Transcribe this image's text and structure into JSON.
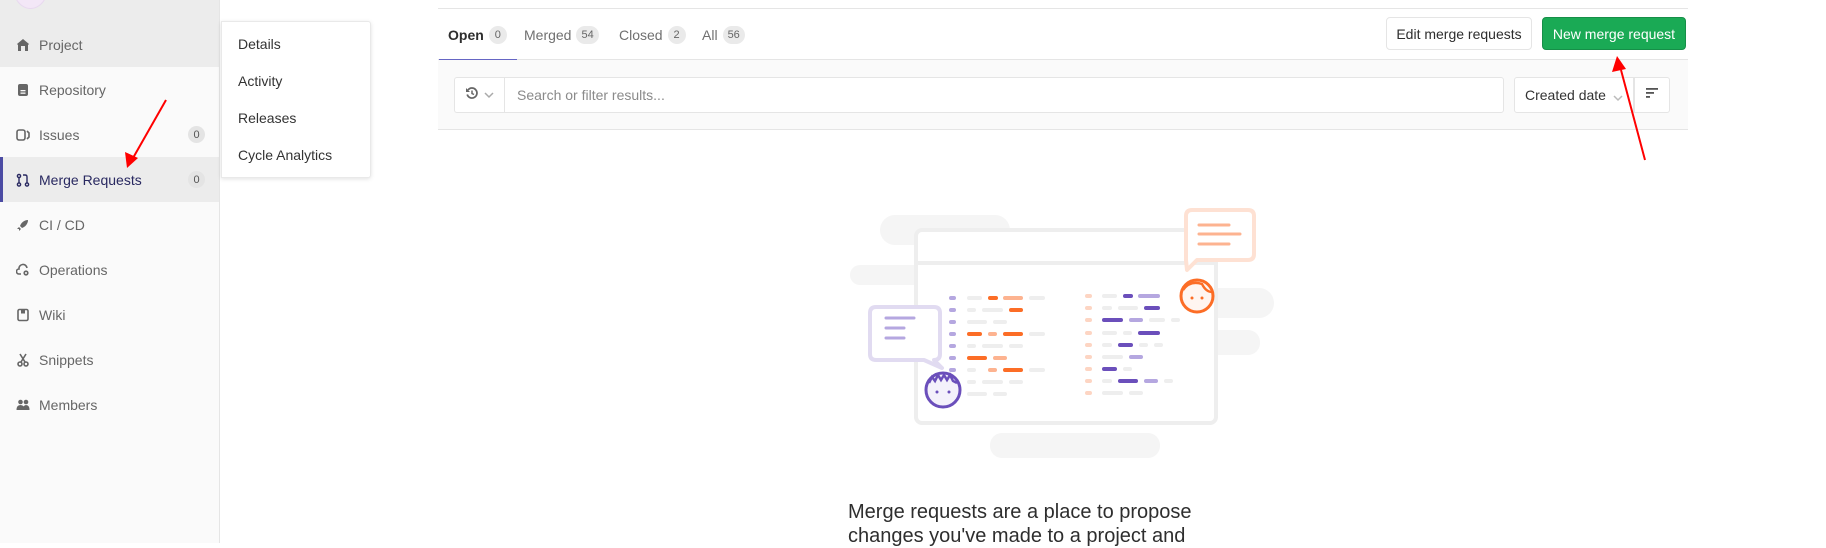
{
  "sidebar": {
    "items": [
      {
        "label": "Project",
        "icon": "home-icon"
      },
      {
        "label": "Repository",
        "icon": "document-icon"
      },
      {
        "label": "Issues",
        "icon": "issues-icon",
        "count": "0"
      },
      {
        "label": "Merge Requests",
        "icon": "git-merge-icon",
        "count": "0",
        "active": true
      },
      {
        "label": "CI / CD",
        "icon": "rocket-icon"
      },
      {
        "label": "Operations",
        "icon": "cloud-gear-icon"
      },
      {
        "label": "Wiki",
        "icon": "book-icon"
      },
      {
        "label": "Snippets",
        "icon": "scissors-icon"
      },
      {
        "label": "Members",
        "icon": "users-icon"
      }
    ]
  },
  "flyout": {
    "items": [
      "Details",
      "Activity",
      "Releases",
      "Cycle Analytics"
    ]
  },
  "tabs": [
    {
      "label": "Open",
      "count": "0",
      "active": true
    },
    {
      "label": "Merged",
      "count": "54"
    },
    {
      "label": "Closed",
      "count": "2"
    },
    {
      "label": "All",
      "count": "56"
    }
  ],
  "actions": {
    "edit_label": "Edit merge requests",
    "new_label": "New merge request",
    "new_color": "#1aaa55"
  },
  "filter": {
    "search_placeholder": "Search or filter results...",
    "sort_label": "Created date"
  },
  "empty_state": {
    "title": "Merge requests are a place to propose changes you've made to a project and"
  },
  "colors": {
    "accent": "#6666c4",
    "annotation_arrow": "#ff0000"
  }
}
